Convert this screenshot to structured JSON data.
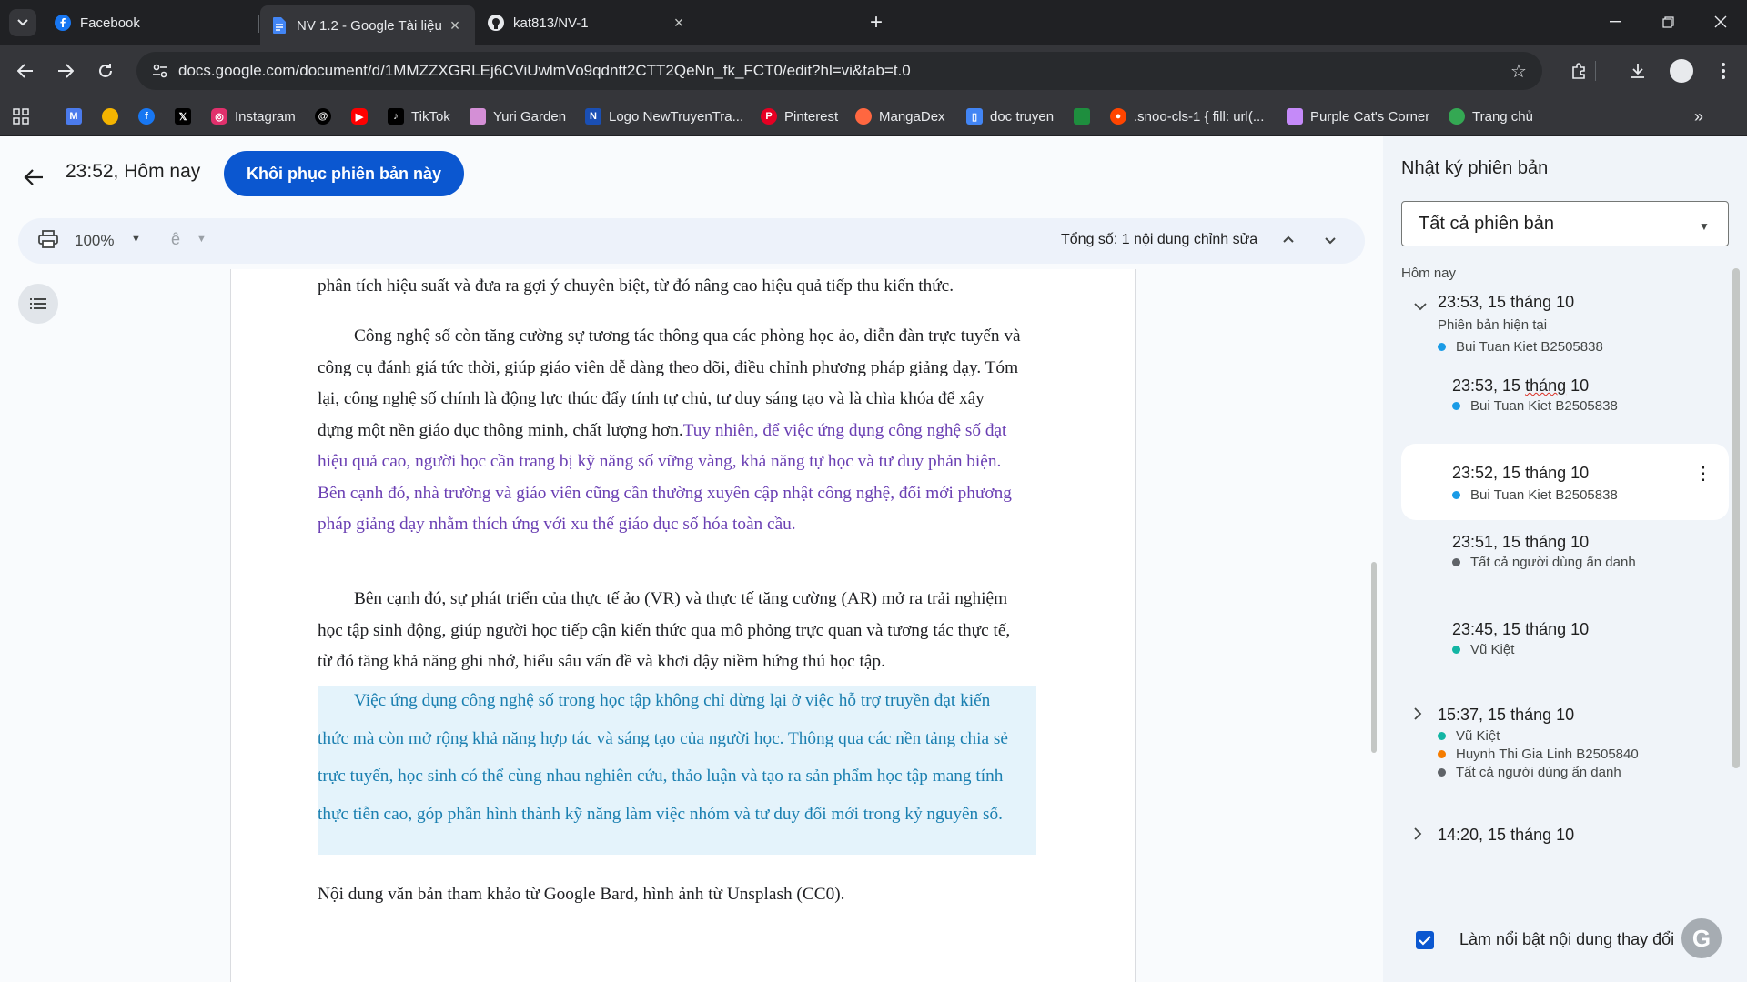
{
  "browser": {
    "tabs": [
      {
        "title": "Facebook",
        "icon": "facebook-icon"
      },
      {
        "title": "NV 1.2 - Google Tài liệu",
        "icon": "google-docs-icon"
      },
      {
        "title": "kat813/NV-1",
        "icon": "github-icon"
      }
    ],
    "active_tab_index": 1,
    "url": "docs.google.com/document/d/1MMZZXGRLEj6CViUwlmVo9qdntt2CTT2QeNn_fk_FCT0/edit?hl=vi&tab=t.0",
    "bookmarks": [
      {
        "label": "",
        "icon": "gmail-icon",
        "color": "#4b7bec"
      },
      {
        "label": "",
        "icon": "chrome-icon",
        "color": "#f4b400"
      },
      {
        "label": "",
        "icon": "facebook-icon",
        "color": "#1877f2"
      },
      {
        "label": "",
        "icon": "x-icon",
        "color": "#000000"
      },
      {
        "label": "Instagram",
        "icon": "instagram-icon",
        "color": "#e1306c"
      },
      {
        "label": "",
        "icon": "threads-icon",
        "color": "#000000"
      },
      {
        "label": "",
        "icon": "youtube-icon",
        "color": "#ff0000"
      },
      {
        "label": "TikTok",
        "icon": "tiktok-icon",
        "color": "#000000"
      },
      {
        "label": "Yuri Garden",
        "icon": "yuri-garden-icon",
        "color": "#d48fd6"
      },
      {
        "label": "Logo NewTruyenTra...",
        "icon": "newtruyen-icon",
        "color": "#1a4fb4"
      },
      {
        "label": "Pinterest",
        "icon": "pinterest-icon",
        "color": "#e60023"
      },
      {
        "label": "MangaDex",
        "icon": "mangadex-icon",
        "color": "#ff6740"
      },
      {
        "label": "doc truyen",
        "icon": "book-icon",
        "color": "#4285f4"
      },
      {
        "label": "",
        "icon": "site-icon",
        "color": "#1e8e3e"
      },
      {
        "label": ".snoo-cls-1 { fill: url(...",
        "icon": "reddit-icon",
        "color": "#ff4500"
      },
      {
        "label": "Purple Cat's Corner",
        "icon": "purple-cat-icon",
        "color": "#c58af9"
      },
      {
        "label": "Trang chủ",
        "icon": "home-figure-icon",
        "color": "#34a853"
      }
    ]
  },
  "docs": {
    "version_title": "23:52, Hôm nay",
    "restore_label": "Khôi phục phiên bản này",
    "zoom": "100%",
    "edits_summary": "Tổng số: 1 nội dung chỉnh sửa",
    "paragraphs": {
      "p1": [
        "phân tích hiệu suất và đưa ra gợi ý chuyên biệt, từ đó nâng cao hiệu quả tiếp thu kiến thức."
      ],
      "p2": [
        {
          "text": "Công nghệ số còn tăng cường sự tương tác thông qua các phòng học ảo, diễn đàn trực tuyến và",
          "added": ""
        },
        {
          "text": "công cụ đánh giá tức thời, giúp giáo viên dễ dàng theo dõi, điều chỉnh phương pháp giảng dạy. Tóm",
          "added": ""
        },
        {
          "text": "lại, công nghệ số chính là động lực thúc đẩy tính tự chủ, tư duy sáng tạo và là chìa khóa để xây",
          "added": ""
        },
        {
          "text": "dựng một nền giáo dục thông minh, chất lượng hơn.",
          "added": "Tuy nhiên, để việc ứng dụng công nghệ số đạt"
        },
        {
          "text": "",
          "added": "hiệu quả cao, người học cần trang bị kỹ năng số vững vàng, khả năng tự học và tư duy phản biện."
        },
        {
          "text": "",
          "added": "Bên cạnh đó, nhà trường và giáo viên cũng cần thường xuyên cập nhật công nghệ, đổi mới phương"
        },
        {
          "text": "",
          "added": "pháp giảng dạy nhằm thích ứng với xu thế giáo dục số hóa toàn cầu."
        }
      ],
      "p3": [
        "Bên cạnh đó, sự phát triển của thực tế ảo (VR) và thực tế tăng cường (AR) mở ra trải nghiệm",
        "học tập sinh động, giúp người học tiếp cận kiến thức qua mô phỏng trực quan và tương tác thực tế,",
        "từ đó tăng khả năng ghi nhớ, hiểu sâu vấn đề và khơi dậy niềm hứng thú học tập."
      ],
      "p4": [
        "Việc ứng dụng công nghệ số trong học tập không chỉ dừng lại ở việc hỗ trợ truyền đạt kiến",
        "thức mà còn mở rộng khả năng hợp tác và sáng tạo của người học. Thông qua các nền tảng chia sẻ",
        "trực tuyến, học sinh có thể cùng nhau nghiên cứu, thảo luận và tạo ra sản phẩm học tập mang tính",
        "thực tiễn cao, góp phần hình thành kỹ năng làm việc nhóm và tư duy đổi mới trong kỷ nguyên số."
      ],
      "p5": [
        "Nội dung văn bản tham khảo từ Google Bard, hình ảnh từ Unsplash (CC0)."
      ]
    }
  },
  "history": {
    "title": "Nhật ký phiên bản",
    "filter": "Tất cả phiên bản",
    "section_today": "Hôm nay",
    "versions": [
      {
        "time": "23:53, 15 tháng 10",
        "sub": "Phiên bản hiện tại",
        "users": [
          {
            "name": "Bui Tuan Kiet B2505838",
            "color": "#1a9be6"
          }
        ],
        "expanded": true
      },
      {
        "time": "23:53, 15 tháng 10",
        "users": [
          {
            "name": "Bui Tuan Kiet B2505838",
            "color": "#1a9be6"
          }
        ]
      },
      {
        "time": "23:52, 15 tháng 10",
        "users": [
          {
            "name": "Bui Tuan Kiet B2505838",
            "color": "#1a9be6"
          }
        ],
        "selected": true
      },
      {
        "time": "23:51, 15 tháng 10",
        "users": [
          {
            "name": "Tất cả người dùng ẩn danh",
            "color": "#5f6368"
          }
        ]
      },
      {
        "time": "23:45, 15 tháng 10",
        "users": [
          {
            "name": "Vũ Kiệt",
            "color": "#12b5a4"
          }
        ]
      },
      {
        "time": "15:37, 15 tháng 10",
        "users": [
          {
            "name": "Vũ Kiệt",
            "color": "#12b5a4"
          },
          {
            "name": "Huynh Thi Gia Linh B2505840",
            "color": "#f57c00"
          },
          {
            "name": "Tất cả người dùng ẩn danh",
            "color": "#5f6368"
          }
        ]
      },
      {
        "time": "14:20, 15 tháng 10",
        "users": []
      }
    ],
    "highlight_label": "Làm nổi bật nội dung thay đổi",
    "highlight_checked": true
  }
}
